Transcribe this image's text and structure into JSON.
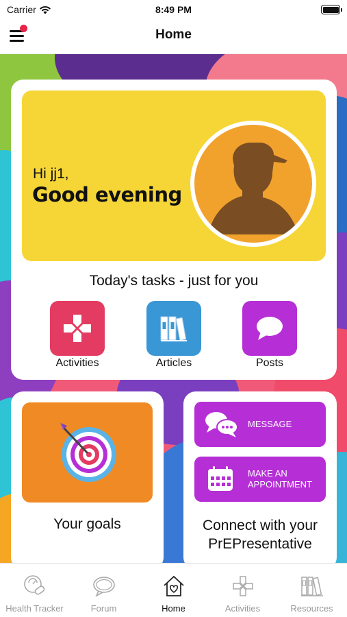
{
  "status_bar": {
    "carrier": "Carrier",
    "time": "8:49 PM"
  },
  "nav": {
    "title": "Home"
  },
  "greeting": {
    "hi": "Hi jj1,",
    "message": "Good evening"
  },
  "tasks": {
    "title": "Today's tasks - just for you",
    "items": [
      {
        "label": "Activities",
        "icon": "gamepad-icon",
        "color": "#e33b61"
      },
      {
        "label": "Articles",
        "icon": "books-icon",
        "color": "#3a97d6"
      },
      {
        "label": "Posts",
        "icon": "speech-bubble-icon",
        "color": "#b62fd6"
      }
    ]
  },
  "goals": {
    "label": "Your goals",
    "icon": "target-icon"
  },
  "connect": {
    "message_label": "MESSAGE",
    "appointment_label": "MAKE AN APPOINTMENT",
    "title": "Connect with your PrEPresentative"
  },
  "tab_bar": {
    "items": [
      {
        "label": "Health Tracker",
        "icon": "health-tracker-icon"
      },
      {
        "label": "Forum",
        "icon": "forum-icon"
      },
      {
        "label": "Home",
        "icon": "home-icon",
        "active": true
      },
      {
        "label": "Activities",
        "icon": "gamepad-icon"
      },
      {
        "label": "Resources",
        "icon": "books-icon"
      }
    ]
  },
  "colors": {
    "greeting_panel": "#f6d637",
    "avatar_bg": "#f1a22c",
    "goals_tile": "#f08a24",
    "connect_button": "#b62fd6",
    "notification_dot": "#e8244a"
  }
}
